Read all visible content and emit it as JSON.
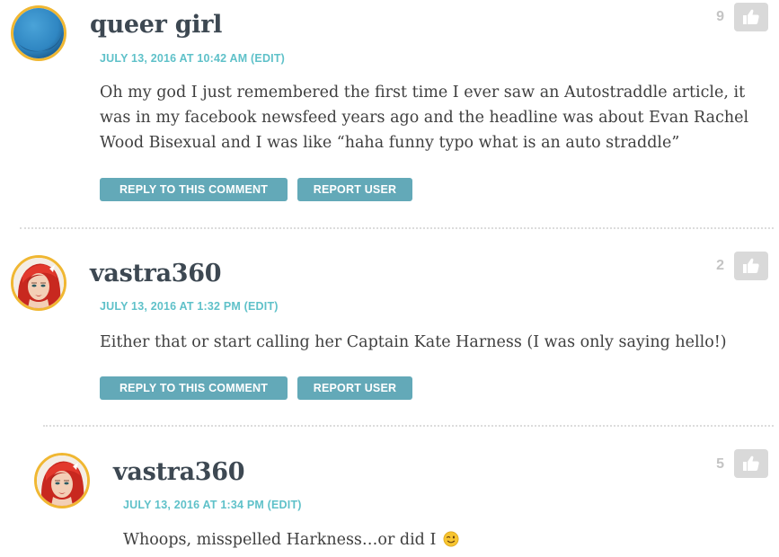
{
  "comments": [
    {
      "author": "queer girl",
      "date": "JULY 13, 2016 AT 10:42 AM",
      "edit_label": "(EDIT)",
      "text": "Oh my god I just remembered the first time I ever saw an Autostraddle article, it was in my facebook newsfeed years ago and the headline was about Evan Rachel Wood Bisexual and I was like “haha funny typo what is an auto straddle”",
      "votes": "9",
      "avatar": "blue-circle-avatar"
    },
    {
      "author": "vastra360",
      "date": "JULY 13, 2016 AT 1:32 PM",
      "edit_label": "(EDIT)",
      "text": "Either that or start calling her Captain Kate Harness (I was only saying hello!)",
      "votes": "2",
      "avatar": "red-haired-woman-avatar"
    },
    {
      "author": "vastra360",
      "date": "JULY 13, 2016 AT 1:34 PM",
      "edit_label": "(EDIT)",
      "text": "Whoops, misspelled Harkness…or did I",
      "emoji": "winking-face-emoji",
      "votes": "5",
      "avatar": "red-haired-woman-avatar"
    }
  ],
  "actions": {
    "reply_label": "REPLY TO THIS COMMENT",
    "report_label": "REPORT USER"
  },
  "icons": {
    "like": "thumbs-up-icon"
  },
  "colors": {
    "author": "#3d4852",
    "meta": "#5fc1c9",
    "button": "#63a9b8",
    "avatar_border": "#f0b732",
    "like_bg": "#d9d9d9",
    "vote_count": "#c4c4c4"
  }
}
